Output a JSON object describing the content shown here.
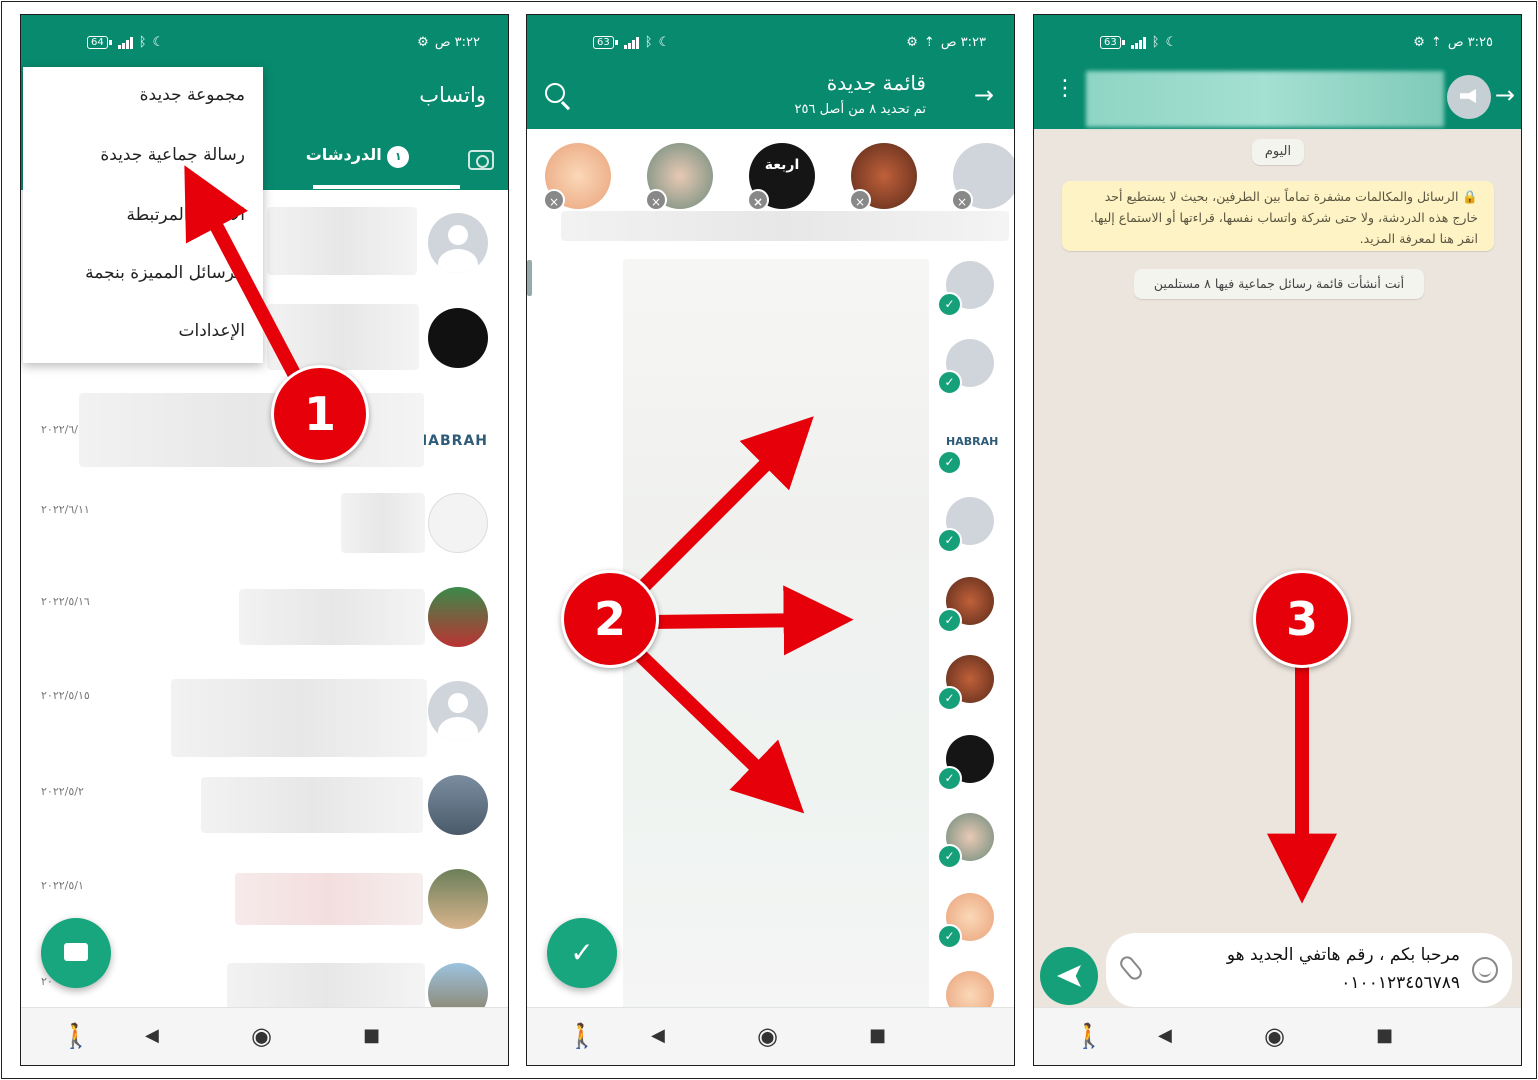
{
  "status": {
    "p1": {
      "time": "٣:٢٢ ص",
      "battery": "64"
    },
    "p2": {
      "time": "٣:٢٣ ص",
      "battery": "63"
    },
    "p3": {
      "time": "٣:٢٥ ص",
      "battery": "63"
    }
  },
  "screen1": {
    "app_title": "واتساب",
    "tab_label": "الدردشات",
    "tab_badge": "١",
    "menu": [
      "مجموعة جديدة",
      "رسالة جماعية جديدة",
      "الأجهزة المرتبطة",
      "الرسائل المميزة بنجمة",
      "الإعدادات"
    ],
    "brand_text": "HABRAH",
    "dates": [
      "٢٠٢٢/٦/",
      "٢٠٢٢/٦/١١",
      "٢٠٢٢/٥/١٦",
      "٢٠٢٢/٥/١٥",
      "٢٠٢٢/٥/٢",
      "٢٠٢٢/٥/١",
      "٢٠"
    ]
  },
  "screen2": {
    "title": "قائمة جديدة",
    "subtitle": "تم تحديد ٨ من أصل ٢٥٦",
    "brand_text": "HABRAH",
    "selected_label": "اربعة",
    "checkmark": "✓"
  },
  "screen3": {
    "date_pill": "اليوم",
    "encryption_notice": "الرسائل والمكالمات مشفرة تماماً بين الطرفين، بحيث لا يستطيع أحد خارج هذه الدردشة، ولا حتى شركة واتساب نفسها، قراءتها أو الاستماع إليها. انقر هنا لمعرفة المزيد.",
    "system_message": "أنت أنشأت قائمة رسائل جماعية فيها ٨ مستلمين",
    "message_line1": "مرحبا بكم ، رقم هاتفي الجديد هو",
    "message_line2": "٠١٠٠١٢٣٤٥٦٧٨٩"
  },
  "annotations": {
    "step1": "1",
    "step2": "2",
    "step3": "3"
  },
  "icons": {
    "back": "→",
    "close": "×",
    "nav_back": "◀",
    "nav_home": "◉",
    "nav_recent": "■",
    "accessibility": "🚶"
  },
  "colors": {
    "header": "#078a6e",
    "fab": "#17a67e",
    "arrow": "#e5000a",
    "chat_bg": "#ece5dd"
  }
}
